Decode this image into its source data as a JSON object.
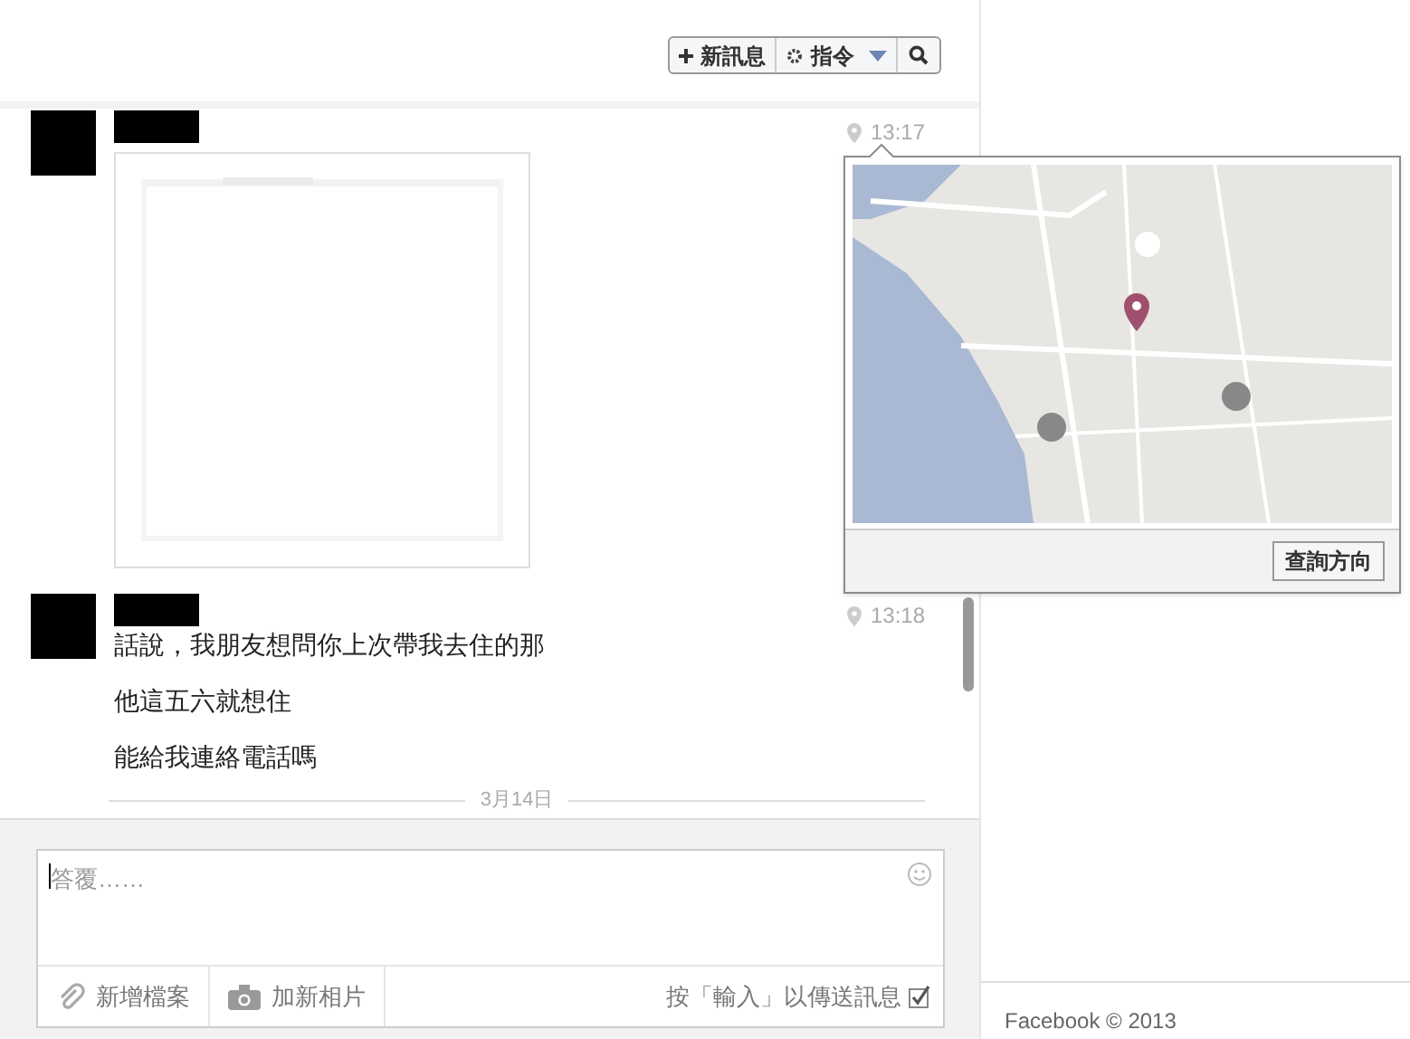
{
  "toolbar": {
    "new_message": "新訊息",
    "actions": "指令"
  },
  "messages": [
    {
      "time": "13:17"
    },
    {
      "time": "13:18",
      "kind": "text",
      "lines": [
        "話說，我朋友想問你上次帶我去住的那",
        "他這五六就想住",
        "能給我連絡電話嗎"
      ]
    }
  ],
  "map_popup": {
    "button": "查詢方向"
  },
  "date_divider": "3月14日",
  "composer": {
    "placeholder": "答覆……",
    "attach_file": "新增檔案",
    "add_photo": "加新相片",
    "send_hint": "按「輸入」以傳送訊息",
    "enter_to_send": true
  },
  "footer": "Facebook © 2013"
}
